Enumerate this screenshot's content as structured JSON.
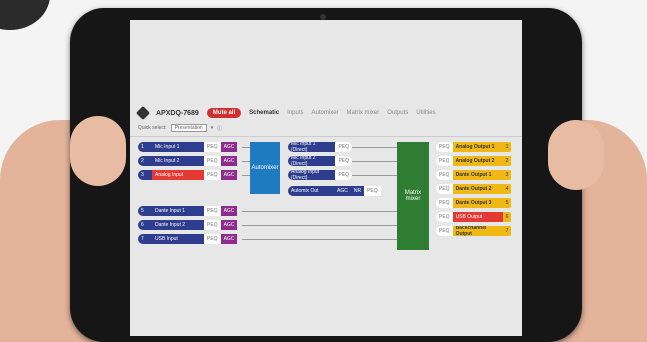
{
  "header": {
    "device": "APXDQ-7689",
    "mute_all": "Mute all",
    "tabs": [
      "Schematic",
      "Inputs",
      "Automixer",
      "Matrix mixer",
      "Outputs",
      "Utilities"
    ],
    "preset_label": "Quick select:",
    "preset_value": "Presentation"
  },
  "inputs": [
    {
      "num": "1",
      "name": "Mic Input 1",
      "peq": "PEQ",
      "agc": "AGC",
      "color": "navy"
    },
    {
      "num": "2",
      "name": "Mic Input 2",
      "peq": "PEQ",
      "agc": "AGC",
      "color": "navy"
    },
    {
      "num": "3",
      "name": "Analog Input",
      "peq": "PEQ",
      "agc": "AGC",
      "color": "red"
    },
    {
      "num": "5",
      "name": "Dante Input 1",
      "peq": "PEQ",
      "agc": "AGC",
      "color": "navy"
    },
    {
      "num": "6",
      "name": "Dante Input 2",
      "peq": "PEQ",
      "agc": "AGC",
      "color": "navy"
    },
    {
      "num": "7",
      "name": "USB Input",
      "peq": "PEQ",
      "agc": "AGC",
      "color": "navy"
    }
  ],
  "automixer": {
    "label": "Automixer",
    "direct": [
      "Mic Input 1 (Direct)",
      "Mic Input 2 (Direct)",
      "Analog Input (Direct)"
    ],
    "peq": "PEQ",
    "out": {
      "name": "Automix Out",
      "agc": "AGC",
      "nr": "NR",
      "peq": "PEQ"
    }
  },
  "matrix": {
    "label": "Matrix mixer"
  },
  "outputs": [
    {
      "peq": "PEQ",
      "name": "Analog Output 1",
      "num": "1",
      "color": "yellow"
    },
    {
      "peq": "PEQ",
      "name": "Analog Output 2",
      "num": "2",
      "color": "yellow"
    },
    {
      "peq": "PEQ",
      "name": "Dante Output 1",
      "num": "3",
      "color": "yellow"
    },
    {
      "peq": "PEQ",
      "name": "Dante Output 2",
      "num": "4",
      "color": "yellow"
    },
    {
      "peq": "PEQ",
      "name": "Dante Output 3",
      "num": "5",
      "color": "yellow"
    },
    {
      "peq": "PEQ",
      "name": "USB Output",
      "num": "6",
      "color": "red"
    },
    {
      "peq": "PEQ",
      "name": "Backchannel Output",
      "num": "7",
      "color": "yellow"
    }
  ]
}
